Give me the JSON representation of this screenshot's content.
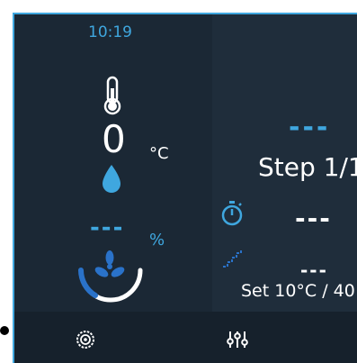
{
  "status": {
    "time": "10:19"
  },
  "climate": {
    "temperature_value": "0",
    "temperature_unit": "°C",
    "humidity_value": "---",
    "humidity_unit": "%",
    "fan_level_fraction": 0.25
  },
  "program": {
    "top_value": "---",
    "step_label": "Step 1/1",
    "timer_value": "---",
    "ramp_value": "---",
    "setpoint_text": "Set 10°C / 40"
  },
  "footer": {
    "icons": [
      "settings-gear-icon",
      "sliders-icon"
    ]
  },
  "colors": {
    "accent": "#3fa7df",
    "background": "#1d2a38",
    "text": "#ffffff"
  }
}
